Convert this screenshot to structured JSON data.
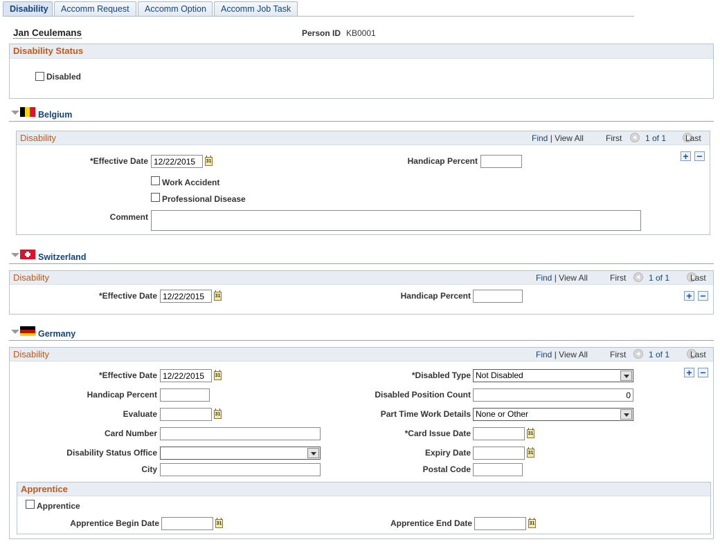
{
  "tabs": [
    {
      "label": "Disability",
      "active": true
    },
    {
      "label": "Accomm Request",
      "active": false
    },
    {
      "label": "Accomm Option",
      "active": false
    },
    {
      "label": "Accomm Job Task",
      "active": false
    }
  ],
  "person": {
    "name": "Jan Ceulemans",
    "id_label": "Person ID",
    "id_value": "KB0001"
  },
  "disability_status": {
    "title": "Disability Status",
    "disabled_label": "Disabled",
    "disabled_checked": false
  },
  "nav": {
    "find": "Find",
    "sep": "|",
    "view_all": "View All",
    "first": "First",
    "count": "1 of 1",
    "last": "Last"
  },
  "belgium": {
    "country": "Belgium",
    "section_title": "Disability",
    "effective_date_label": "*Effective Date",
    "effective_date": "12/22/2015",
    "handicap_percent_label": "Handicap Percent",
    "handicap_percent": "",
    "work_accident_label": "Work Accident",
    "professional_disease_label": "Professional Disease",
    "comment_label": "Comment",
    "comment": ""
  },
  "switzerland": {
    "country": "Switzerland",
    "section_title": "Disability",
    "effective_date_label": "*Effective Date",
    "effective_date": "12/22/2015",
    "handicap_percent_label": "Handicap Percent",
    "handicap_percent": ""
  },
  "germany": {
    "country": "Germany",
    "section_title": "Disability",
    "effective_date_label": "*Effective Date",
    "effective_date": "12/22/2015",
    "disabled_type_label": "*Disabled Type",
    "disabled_type": "Not Disabled",
    "handicap_percent_label": "Handicap Percent",
    "handicap_percent": "",
    "disabled_position_count_label": "Disabled Position Count",
    "disabled_position_count": "0",
    "evaluate_label": "Evaluate",
    "evaluate": "",
    "part_time_label": "Part Time Work Details",
    "part_time": "None or Other",
    "card_number_label": "Card Number",
    "card_number": "",
    "card_issue_date_label": "*Card Issue Date",
    "card_issue_date": "",
    "status_office_label": "Disability Status Office",
    "status_office": "",
    "expiry_date_label": "Expiry Date",
    "expiry_date": "",
    "city_label": "City",
    "city": "",
    "postal_code_label": "Postal Code",
    "postal_code": "",
    "apprentice": {
      "title": "Apprentice",
      "checkbox_label": "Apprentice",
      "begin_date_label": "Apprentice Begin Date",
      "begin_date": "",
      "end_date_label": "Apprentice End Date",
      "end_date": ""
    }
  },
  "icons": {
    "calendar": "31",
    "add": "+",
    "delete": "−"
  }
}
